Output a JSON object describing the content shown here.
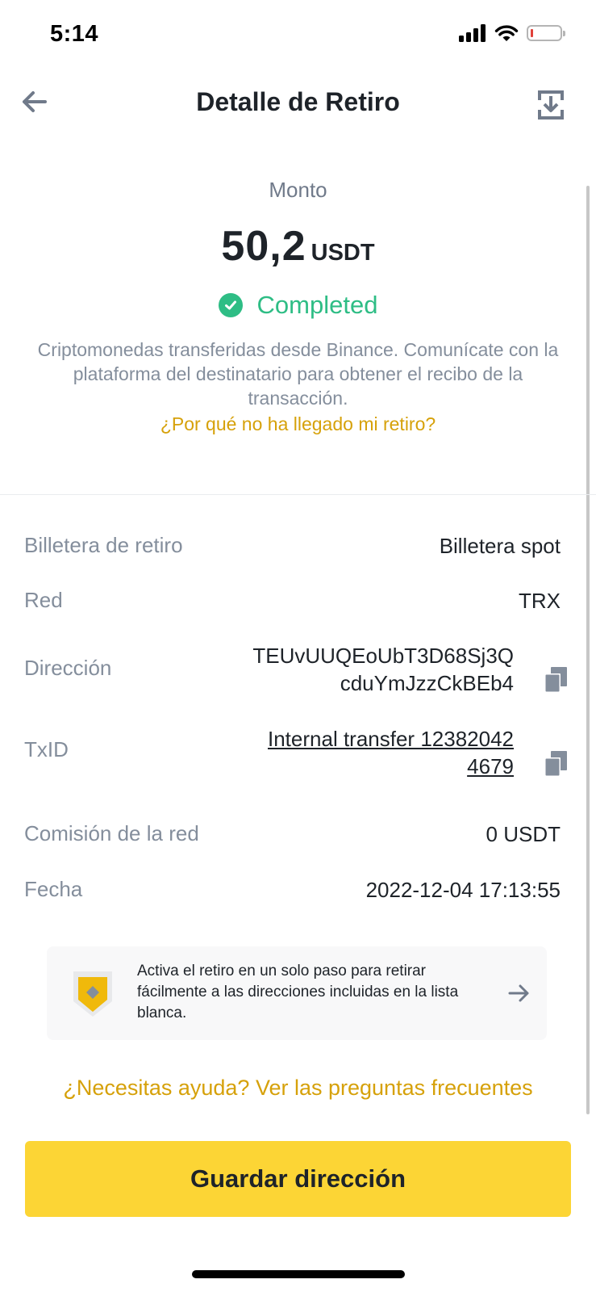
{
  "status_bar": {
    "time": "5:14",
    "icons": [
      "cellular-signal-icon",
      "wifi-icon",
      "battery-low-icon"
    ]
  },
  "header": {
    "title": "Detalle de Retiro",
    "back_icon": "arrow-left-icon",
    "export_icon": "download-export-icon"
  },
  "summary": {
    "amount_label": "Monto",
    "amount": "50,2",
    "currency": "USDT",
    "status": "Completed",
    "description": "Criptomonedas transferidas desde Binance. Comunícate con la plataforma del destinatario para obtener el recibo de la transacción.",
    "help_link": "¿Por qué no ha llegado mi retiro?"
  },
  "details": {
    "wallet": {
      "label": "Billetera de retiro",
      "value": "Billetera spot"
    },
    "network": {
      "label": "Red",
      "value": "TRX"
    },
    "address": {
      "label": "Dirección",
      "value_line1": "TEUvUUQEoUbT3D68Sj3Q",
      "value_line2": "cduYmJzzCkBEb4"
    },
    "txid": {
      "label": "TxID",
      "value_line1": "Internal transfer 12382042",
      "value_line2": "4679"
    },
    "fee": {
      "label": "Comisión de la red",
      "value": "0 USDT"
    },
    "date": {
      "label": "Fecha",
      "value": "2022-12-04 17:13:55"
    }
  },
  "banner": {
    "text": "Activa el retiro en un solo paso para retirar fácilmente a las direcciones incluidas en la lista blanca."
  },
  "faq_link": "¿Necesitas ayuda? Ver las preguntas frecuentes",
  "save_button": "Guardar dirección",
  "colors": {
    "accent_yellow": "#fcd535",
    "link_gold": "#d6a10a",
    "success_green": "#2ebd85",
    "text_primary": "#1e2329",
    "text_secondary": "#848e9c"
  }
}
